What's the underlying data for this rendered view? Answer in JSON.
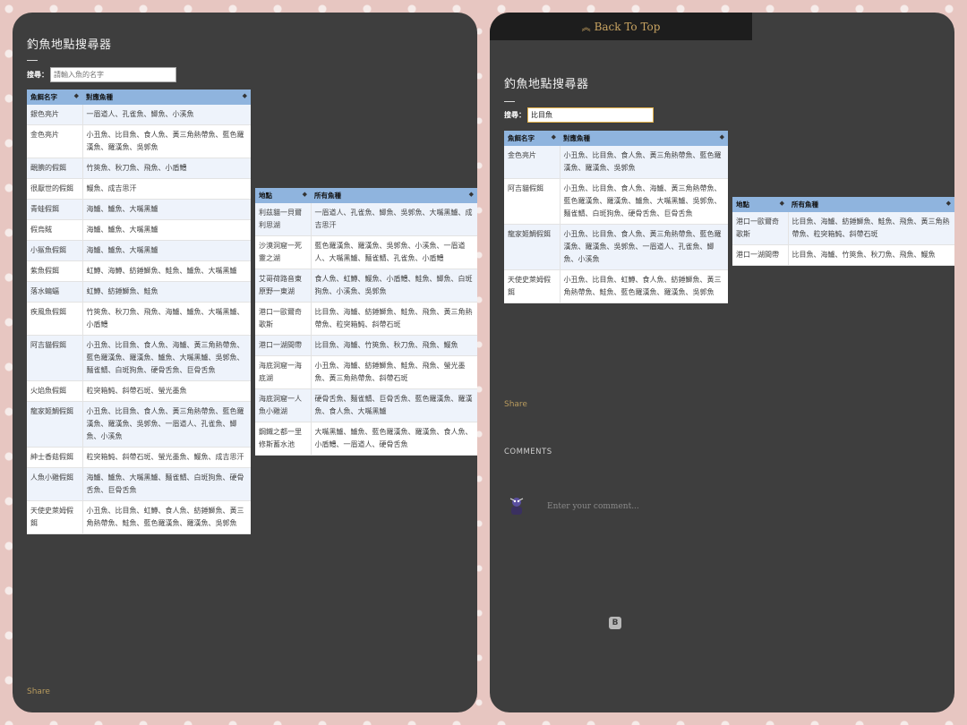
{
  "left": {
    "title": "釣魚地點搜尋器",
    "search_label": "搜尋：",
    "search_value": "",
    "search_placeholder": "請輸入魚的名字",
    "bait_table": {
      "headers": [
        "魚餌名字",
        "對應魚種"
      ],
      "rows": [
        [
          "銀色亮片",
          "一眉道人、孔雀魚、鯽魚、小溪魚"
        ],
        [
          "金色亮片",
          "小丑魚、比目魚、食人魚、黃三角熱帶魚、藍色羅漢魚、羅漢魚、吳郭魚"
        ],
        [
          "靦腆的假餌",
          "竹筴魚、秋刀魚、飛魚、小盾鱧"
        ],
        [
          "很厭世的假餌",
          "鰻魚、成吉思汗"
        ],
        [
          "青蛙假餌",
          "海鱸、鱸魚、大嘴黑鱸"
        ],
        [
          "假烏賊",
          "海鱸、鱸魚、大嘴黑鱸"
        ],
        [
          "小鯊魚假餌",
          "海鱸、鱸魚、大嘴黑鱸"
        ],
        [
          "紫魚假餌",
          "虹鱒、海鱒、紡錘鰤魚、鮭魚、鱸魚、大嘴黑鱸"
        ],
        [
          "落水蝙蝠",
          "虹鱒、紡錘鰤魚、鮭魚"
        ],
        [
          "疾風魚假餌",
          "竹筴魚、秋刀魚、飛魚、海鱸、鱸魚、大嘴黑鱸、小盾鱧"
        ],
        [
          "阿吉貓假餌",
          "小丑魚、比目魚、食人魚、海鱸、黃三角熱帶魚、藍色羅漢魚、羅漢魚、鱸魚、大嘴黑鱸、吳郭魚、麵雀鯖、白斑狗魚、硬骨舌魚、巨骨舌魚"
        ],
        [
          "火焰魚假餌",
          "粒突箱魨、斜帶石斑、螢光墨魚"
        ],
        [
          "龍家姬鯛假餌",
          "小丑魚、比目魚、食人魚、黃三角熱帶魚、藍色羅漢魚、羅漢魚、吳郭魚、一眉道人、孔雀魚、鯽魚、小溪魚"
        ],
        [
          "紳士香菇假餌",
          "粒突箱魨、斜帶石斑、螢光墨魚、鰻魚、成吉思汗"
        ],
        [
          "人魚小雞假餌",
          "海鱸、鱸魚、大嘴黑鱸、麵雀鯖、白斑狗魚、硬骨舌魚、巨骨舌魚"
        ],
        [
          "天使史萊姆假餌",
          "小丑魚、比目魚、虹鱒、食人魚、紡錘鰤魚、黃三角熱帶魚、鮭魚、藍色羅漢魚、羅漢魚、吳郭魚"
        ]
      ]
    },
    "location_table": {
      "headers": [
        "地點",
        "所有魚種"
      ],
      "rows": [
        [
          "利茲貓一貝爾利思湖",
          "一眉道人、孔雀魚、鯽魚、吳郭魚、大嘴黑鱸、成吉思汗"
        ],
        [
          "沙漠洞窟一死靈之湖",
          "藍色羅漢魚、羅漢魚、吳郭魚、小溪魚、一眉道人、大嘴黑鱸、麵雀鯖、孔雀魚、小盾鱧"
        ],
        [
          "艾哥荷路音東原野一東湖",
          "食人魚、虹鱒、鰻魚、小盾鱧、鮭魚、鯽魚、白斑狗魚、小溪魚、吳郭魚"
        ],
        [
          "港口一歐爾奇歌斯",
          "比目魚、海鱸、紡錘鰤魚、鮭魚、飛魚、黃三角熱帶魚、粒突箱魨、斜帶石斑"
        ],
        [
          "港口一湖間帶",
          "比目魚、海鱸、竹筴魚、秋刀魚、飛魚、鰻魚"
        ],
        [
          "海底洞窟一海底湖",
          "小丑魚、海鱸、紡錘鰤魚、鮭魚、飛魚、螢光墨魚、黃三角熱帶魚、斜帶石斑"
        ],
        [
          "海底洞窟一人魚小雞湖",
          "硬骨舌魚、麵雀鯖、巨骨舌魚、藍色羅漢魚、羅漢魚、食人魚、大嘴黑鱸"
        ],
        [
          "鋼鐵之都一里修斯蓄水池",
          "大嘴黑鱸、鱸魚、藍色羅漢魚、羅漢魚、食人魚、小盾鱧、一眉道人、硬骨舌魚"
        ]
      ]
    },
    "share_label": "Share"
  },
  "right": {
    "back_to_top": "Back To Top",
    "title": "釣魚地點搜尋器",
    "search_label": "搜尋：",
    "search_value": "比目魚",
    "bait_table": {
      "headers": [
        "魚餌名字",
        "對應魚種"
      ],
      "rows": [
        [
          "金色亮片",
          "小丑魚、比目魚、食人魚、黃三角熱帶魚、藍色羅漢魚、羅漢魚、吳郭魚"
        ],
        [
          "阿吉貓假餌",
          "小丑魚、比目魚、食人魚、海鱸、黃三角熱帶魚、藍色羅漢魚、羅漢魚、鱸魚、大嘴黑鱸、吳郭魚、麵雀鯖、白斑狗魚、硬骨舌魚、巨骨舌魚"
        ],
        [
          "龍家姬鯛假餌",
          "小丑魚、比目魚、食人魚、黃三角熱帶魚、藍色羅漢魚、羅漢魚、吳郭魚、一眉道人、孔雀魚、鯽魚、小溪魚"
        ],
        [
          "天使史萊姆假餌",
          "小丑魚、比目魚、虹鱒、食人魚、紡錘鰤魚、黃三角熱帶魚、鮭魚、藍色羅漢魚、羅漢魚、吳郭魚"
        ]
      ]
    },
    "location_table": {
      "headers": [
        "地點",
        "所有魚種"
      ],
      "rows": [
        [
          "港口一歐爾奇歌斯",
          "比目魚、海鱸、紡錘鰤魚、鮭魚、飛魚、黃三角熱帶魚、粒突箱魨、斜帶石斑"
        ],
        [
          "港口一湖間帶",
          "比目魚、海鱸、竹筴魚、秋刀魚、飛魚、鰻魚"
        ]
      ]
    },
    "share_label": "Share",
    "comments_label": "COMMENTS",
    "comment_placeholder": "Enter your comment...",
    "blogger_glyph": "B"
  },
  "sort_glyph": "◆",
  "colors": {
    "panel_bg": "#3e3e3e",
    "table_header": "#8fb4de",
    "accent_gold": "#c9a462",
    "search_focus": "#e6b34a"
  }
}
